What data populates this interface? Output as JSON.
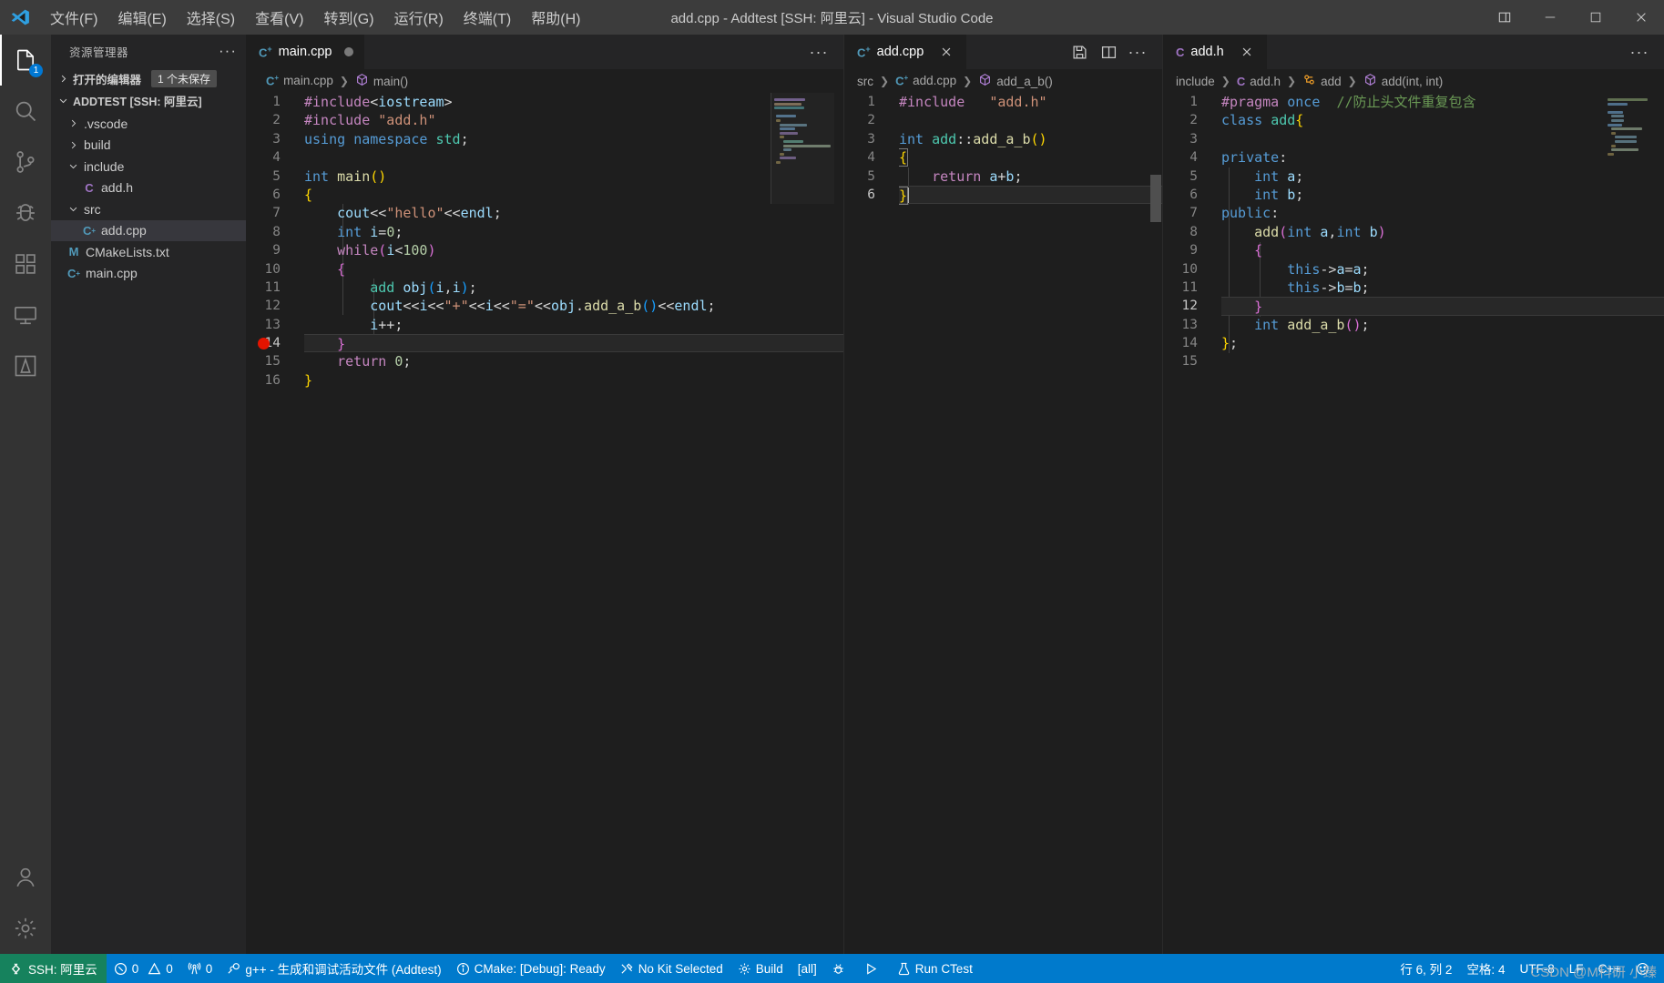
{
  "window": {
    "title": "add.cpp - Addtest [SSH: 阿里云] - Visual Studio Code",
    "minimize": "─",
    "maximize": "□",
    "close": "✕",
    "layout_icon": "editor-layout-icon"
  },
  "menu": [
    {
      "label": "文件(F)"
    },
    {
      "label": "编辑(E)"
    },
    {
      "label": "选择(S)"
    },
    {
      "label": "查看(V)"
    },
    {
      "label": "转到(G)"
    },
    {
      "label": "运行(R)"
    },
    {
      "label": "终端(T)"
    },
    {
      "label": "帮助(H)"
    }
  ],
  "activitybar": {
    "items": [
      {
        "name": "explorer",
        "icon": "files-icon",
        "badge": "1",
        "active": true
      },
      {
        "name": "search",
        "icon": "search-icon",
        "badge": "",
        "active": false
      },
      {
        "name": "source-control",
        "icon": "source-control-icon",
        "badge": "",
        "active": false
      },
      {
        "name": "run-and-debug",
        "icon": "debug-icon",
        "badge": "",
        "active": false
      },
      {
        "name": "extensions",
        "icon": "extensions-icon",
        "badge": "",
        "active": false
      },
      {
        "name": "remote-explorer",
        "icon": "remote-explorer-icon",
        "badge": "",
        "active": false
      },
      {
        "name": "cmake",
        "icon": "cmake-icon",
        "badge": "",
        "active": false
      }
    ],
    "bottom": [
      {
        "name": "accounts",
        "icon": "account-icon"
      },
      {
        "name": "settings",
        "icon": "gear-icon"
      }
    ]
  },
  "sidebar": {
    "title": "资源管理器",
    "more_actions": "···",
    "open_editors": {
      "label": "打开的编辑器",
      "badge": "1 个未保存",
      "collapsed": true
    },
    "project": {
      "label": "ADDTEST [SSH: 阿里云]",
      "expanded": true
    },
    "tree": [
      {
        "label": ".vscode",
        "type": "folder",
        "indent": 1,
        "expanded": false,
        "icon": "chevron-right-icon"
      },
      {
        "label": "build",
        "type": "folder",
        "indent": 1,
        "expanded": false,
        "icon": "chevron-right-icon"
      },
      {
        "label": "include",
        "type": "folder",
        "indent": 1,
        "expanded": true,
        "icon": "chevron-down-icon"
      },
      {
        "label": "add.h",
        "type": "file-h",
        "indent": 2,
        "icon": "c-header-icon"
      },
      {
        "label": "src",
        "type": "folder",
        "indent": 1,
        "expanded": true,
        "icon": "chevron-down-icon"
      },
      {
        "label": "add.cpp",
        "type": "file-cpp",
        "indent": 2,
        "icon": "cpp-icon",
        "selected": true
      },
      {
        "label": "CMakeLists.txt",
        "type": "file-cmake",
        "indent": 1,
        "icon": "cmake-file-icon"
      },
      {
        "label": "main.cpp",
        "type": "file-cpp",
        "indent": 1,
        "icon": "cpp-icon"
      }
    ]
  },
  "editor_groups": [
    {
      "id": "group-1",
      "tabs": [
        {
          "label": "main.cpp",
          "icon": "cpp-icon",
          "active": true,
          "dirty": true,
          "closable": false
        }
      ],
      "actions": [
        "more-actions"
      ],
      "breadcrumb": [
        {
          "label": "main.cpp",
          "icon": "cpp-icon"
        },
        {
          "label": "main()",
          "icon": "symbol-method-icon"
        }
      ],
      "first_line": 1,
      "breakpoint_line": 14,
      "current_line": 14,
      "lines": [
        "#include<iostream>",
        "#include \"add.h\"",
        "using namespace std;",
        "",
        "int main()",
        "{",
        "    cout<<\"hello\"<<endl;",
        "    int i=0;",
        "    while(i<100)",
        "    {",
        "        add obj(i,i);",
        "        cout<<i<<\"+\"<<i<<\"=\"<<obj.add_a_b()<<endl;",
        "        i++;",
        "    }",
        "    return 0;",
        "}"
      ]
    },
    {
      "id": "group-2",
      "tabs": [
        {
          "label": "add.cpp",
          "icon": "cpp-icon",
          "active": true,
          "dirty": false,
          "closable": true
        }
      ],
      "actions": [
        "save-all-icon",
        "split-editor-icon",
        "more-actions"
      ],
      "breadcrumb": [
        {
          "label": "src",
          "icon": ""
        },
        {
          "label": "add.cpp",
          "icon": "cpp-icon"
        },
        {
          "label": "add_a_b()",
          "icon": "symbol-method-icon"
        }
      ],
      "first_line": 1,
      "current_line": 6,
      "lines": [
        "#include   \"add.h\"",
        "",
        "int add::add_a_b()",
        "{",
        "    return a+b;",
        "}"
      ]
    },
    {
      "id": "group-3",
      "tabs": [
        {
          "label": "add.h",
          "icon": "c-header-icon",
          "active": true,
          "dirty": false,
          "closable": true
        }
      ],
      "actions": [
        "more-actions"
      ],
      "breadcrumb": [
        {
          "label": "include",
          "icon": ""
        },
        {
          "label": "add.h",
          "icon": "c-header-icon"
        },
        {
          "label": "add",
          "icon": "symbol-class-icon"
        },
        {
          "label": "add(int, int)",
          "icon": "symbol-method-icon"
        }
      ],
      "first_line": 1,
      "current_line": 12,
      "lines": [
        "#pragma once  //防止头文件重复包含",
        "class add{",
        "",
        "private:",
        "    int a;",
        "    int b;",
        "public:",
        "    add(int a,int b)",
        "    {",
        "        this->a=a;",
        "        this->b=b;",
        "    }",
        "    int add_a_b();",
        "};",
        ""
      ]
    }
  ],
  "statusbar": {
    "remote": {
      "label": "SSH: 阿里云",
      "icon": "remote-icon"
    },
    "left": [
      {
        "name": "problems",
        "icon": "error-icon",
        "label": "0",
        "icon2": "warning-icon",
        "label2": "0"
      },
      {
        "name": "ports",
        "icon": "radio-tower-icon",
        "label": "0"
      },
      {
        "name": "cmake-build-target",
        "icon": "debug-build-icon",
        "label": "g++ - 生成和调试活动文件 (Addtest)"
      },
      {
        "name": "cmake-status",
        "icon": "info-icon",
        "label": "CMake: [Debug]: Ready"
      },
      {
        "name": "cmake-kit",
        "icon": "tools-icon",
        "label": "No Kit Selected"
      },
      {
        "name": "cmake-build",
        "icon": "gear-icon",
        "label": "Build"
      },
      {
        "name": "cmake-target",
        "icon": "",
        "label": "[all]"
      },
      {
        "name": "cmake-debug",
        "icon": "bug-icon",
        "label": ""
      },
      {
        "name": "cmake-run",
        "icon": "play-icon",
        "label": ""
      },
      {
        "name": "cmake-ctest",
        "icon": "beaker-icon",
        "label": "Run CTest"
      }
    ],
    "right": [
      {
        "name": "cursor-position",
        "label": "行 6, 列 2"
      },
      {
        "name": "indentation",
        "label": "空格: 4"
      },
      {
        "name": "encoding",
        "label": "UTF-8"
      },
      {
        "name": "eol",
        "label": "LF"
      },
      {
        "name": "language-mode",
        "label": "C++"
      },
      {
        "name": "feedback",
        "label": ""
      }
    ]
  },
  "watermark": {
    "prefix": "CSDN @M",
    "suffix": "科研 小臻"
  },
  "colors": {
    "statusbar": "#007acc",
    "remote": "#16825d",
    "titlebar": "#3c3c3c",
    "activitybar": "#333333",
    "sidebar": "#252526",
    "editor": "#1e1e1e",
    "breakpoint": "#e51400",
    "accent": "#0078d4"
  }
}
